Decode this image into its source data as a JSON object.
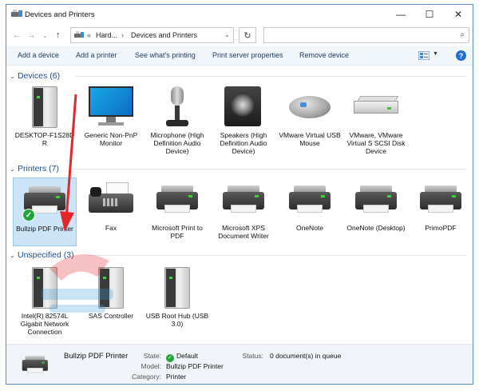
{
  "window": {
    "title": "Devices and Printers",
    "controls": {
      "minimize": "—",
      "maximize": "☐",
      "close": "✕"
    }
  },
  "address": {
    "back": "←",
    "forward": "→",
    "recent": "⌄",
    "up": "↑",
    "overflow": "«",
    "crumbs": [
      "Hard...",
      "Devices and Printers"
    ],
    "separator": "›",
    "dropdown": "⌄",
    "refresh": "↻",
    "search_placeholder": "",
    "search_icon": "⌕"
  },
  "commands": {
    "add_device": "Add a device",
    "add_printer": "Add a printer",
    "see_printing": "See what's printing",
    "server_props": "Print server properties",
    "remove_device": "Remove device",
    "view_dropdown": "▼",
    "help": "?"
  },
  "sections": {
    "devices": {
      "title": "Devices (6)",
      "chevron": "⌄",
      "items": [
        {
          "label": "DESKTOP-F1S28D R",
          "icon": "tower-icon"
        },
        {
          "label": "Generic Non-PnP Monitor",
          "icon": "monitor-icon"
        },
        {
          "label": "Microphone (High Definition Audio Device)",
          "icon": "microphone-icon"
        },
        {
          "label": "Speakers (High Definition Audio Device)",
          "icon": "speaker-icon"
        },
        {
          "label": "VMware Virtual USB Mouse",
          "icon": "mouse-icon"
        },
        {
          "label": "VMware, VMware Virtual S SCSI Disk Device",
          "icon": "disk-icon"
        }
      ]
    },
    "printers": {
      "title": "Printers (7)",
      "chevron": "⌄",
      "items": [
        {
          "label": "Bullzip PDF Printer",
          "icon": "printer-icon",
          "default_check": "✓"
        },
        {
          "label": "Fax",
          "icon": "fax-icon"
        },
        {
          "label": "Microsoft Print to PDF",
          "icon": "printer-icon"
        },
        {
          "label": "Microsoft XPS Document Writer",
          "icon": "printer-icon"
        },
        {
          "label": "OneNote",
          "icon": "printer-icon"
        },
        {
          "label": "OneNote (Desktop)",
          "icon": "printer-icon"
        },
        {
          "label": "PrimoPDF",
          "icon": "printer-icon"
        }
      ]
    },
    "unspecified": {
      "title": "Unspecified (3)",
      "chevron": "⌄",
      "items": [
        {
          "label": "Intel(R) 82574L Gigabit Network Connection",
          "icon": "tower-icon"
        },
        {
          "label": "SAS Controller",
          "icon": "tower-icon"
        },
        {
          "label": "USB Root Hub (USB 3.0)",
          "icon": "tower-icon"
        }
      ]
    }
  },
  "details": {
    "name": "Bullzip PDF Printer",
    "state_label": "State:",
    "state_check": "✓",
    "state_value": "Default",
    "model_label": "Model:",
    "model_value": "Bullzip PDF Printer",
    "category_label": "Category:",
    "category_value": "Printer",
    "status_label": "Status:",
    "status_value": "0 document(s) in queue"
  },
  "colors": {
    "accent": "#1e4f8c",
    "selection": "#cce4f7",
    "check": "#22a43a",
    "arrow": "#e3262a"
  }
}
